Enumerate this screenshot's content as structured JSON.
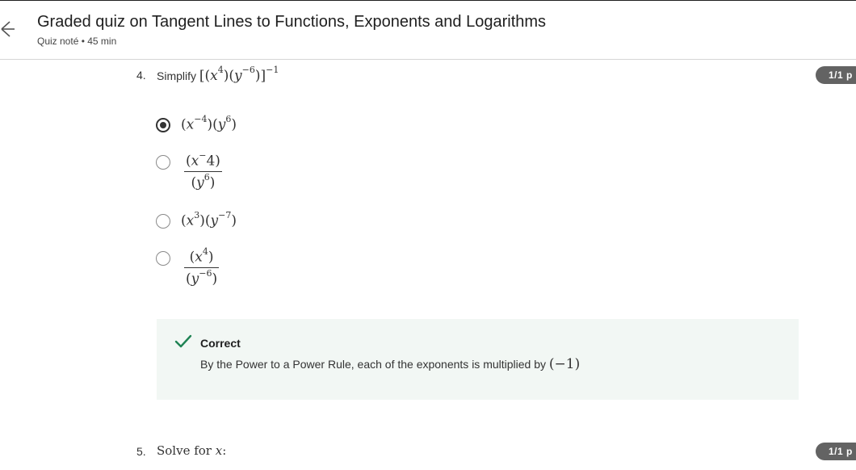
{
  "header": {
    "title": "Graded quiz on Tangent Lines to Functions, Exponents and Logarithms",
    "subtitle": "Quiz noté • 45 min",
    "back_icon": "arrow-left-icon"
  },
  "question4": {
    "number": "4.",
    "prompt": "Simplify",
    "expression": "[(x⁴)(y⁻⁶)]⁻¹",
    "points_badge": "1/1 p",
    "options": [
      {
        "text": "(x⁻⁴)(y⁶)",
        "selected": true
      },
      {
        "numerator": "(x⁻4)",
        "denominator": "(y⁶)",
        "selected": false
      },
      {
        "text": "(x³)(y⁻⁷)",
        "selected": false
      },
      {
        "numerator": "(x⁴)",
        "denominator": "(y⁻⁶)",
        "selected": false
      }
    ],
    "feedback": {
      "status": "Correct",
      "icon": "checkmark-icon",
      "text": "By the Power to a Power Rule, each of the exponents is multiplied by",
      "math": "(−1)",
      "status_color": "#1f8354"
    }
  },
  "question5": {
    "number": "5.",
    "prompt": "Solve for x:",
    "points_badge": "1/1 p"
  }
}
